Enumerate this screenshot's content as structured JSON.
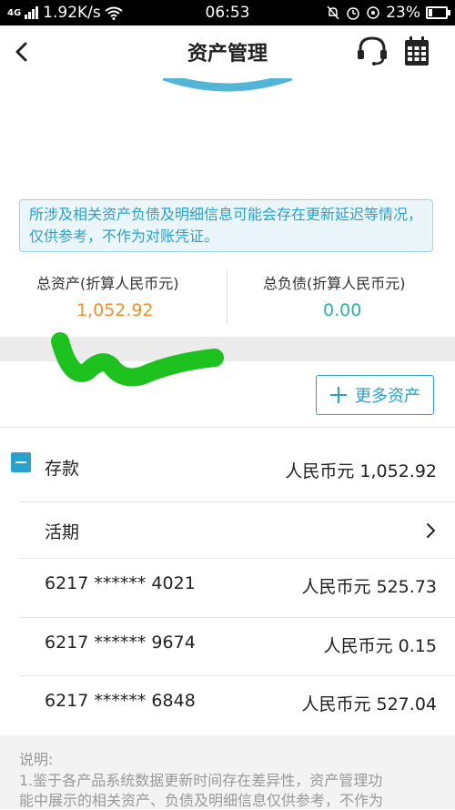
{
  "status_bar": {
    "signal_label": "4G",
    "network_speed": "1.92K/s",
    "time": "06:53",
    "battery": "23%",
    "battery_level": 0.23
  },
  "header": {
    "title": "资产管理",
    "back_icon": "chevron-left-icon",
    "service_icon": "headset-icon",
    "calendar_icon": "calendar-icon"
  },
  "notice": {
    "text": "所涉及相关资产负债及明细信息可能会存在更新延迟等情况，仅供参考，不作为对账凭证。"
  },
  "summary": {
    "assets_label": "总资产(折算人民币元)",
    "assets_value": "1,052.92",
    "liabilities_label": "总负债(折算人民币元)",
    "liabilities_value": "0.00"
  },
  "colors": {
    "accent": "#2aa0cf",
    "assets_value": "#f0912b",
    "liabilities_value": "#2fb3a8",
    "scribble": "#1ec21e"
  },
  "more_assets": {
    "label": "更多资产",
    "icon": "plus-icon"
  },
  "deposit": {
    "title": "存款",
    "total": "人民币元 1,052.92",
    "collapse_icon": "minus-square-icon",
    "demand": {
      "label": "活期",
      "chevron_icon": "chevron-right-icon"
    },
    "accounts": [
      {
        "number": "6217 ****** 4021",
        "amount": "人民币元 525.73"
      },
      {
        "number": "6217 ****** 9674",
        "amount": "人民币元 0.15"
      },
      {
        "number": "6217 ****** 6848",
        "amount": "人民币元 527.04"
      }
    ]
  },
  "footer": {
    "heading": "说明:",
    "line1": "1.鉴于各产品系统数据更新时间存在差异性，资产管理功",
    "line2": "能中展示的相关资产、负债及明细信息仅供参考，不作为"
  }
}
